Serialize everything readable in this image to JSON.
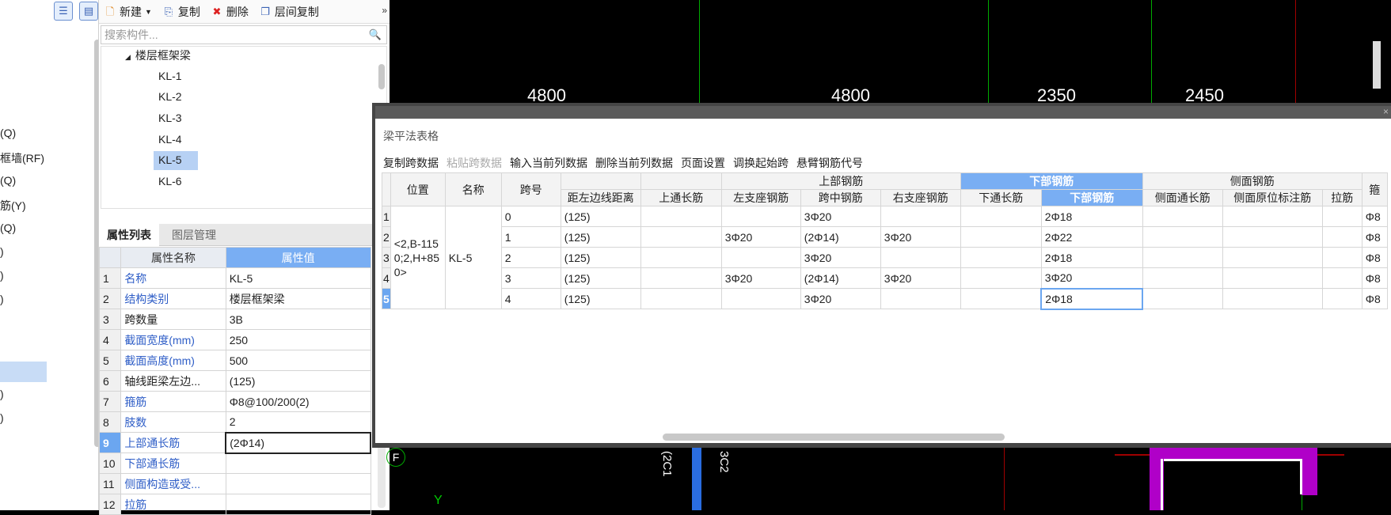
{
  "left_strip": {
    "labels": [
      "(Q)",
      "框墙(RF)",
      "(Q)",
      "筋(Y)",
      "(Q)",
      ")",
      ")",
      ")",
      ")",
      ")"
    ]
  },
  "toolbar": {
    "new": "新建",
    "copy": "复制",
    "delete": "删除",
    "floor_copy": "层间复制",
    "more": "»"
  },
  "search": {
    "placeholder": "搜索构件..."
  },
  "tree": {
    "group": "楼层框架梁",
    "items": [
      "KL-1",
      "KL-2",
      "KL-3",
      "KL-4",
      "KL-5",
      "KL-6"
    ],
    "selected": "KL-5"
  },
  "tabs": {
    "props": "属性列表",
    "layers": "图层管理"
  },
  "props": {
    "col_name": "属性名称",
    "col_value": "属性值",
    "rows": [
      {
        "n": "1",
        "k": "名称",
        "v": "KL-5",
        "blue": true
      },
      {
        "n": "2",
        "k": "结构类别",
        "v": "楼层框架梁",
        "blue": true
      },
      {
        "n": "3",
        "k": "跨数量",
        "v": "3B",
        "blue": false
      },
      {
        "n": "4",
        "k": "截面宽度(mm)",
        "v": "250",
        "blue": true
      },
      {
        "n": "5",
        "k": "截面高度(mm)",
        "v": "500",
        "blue": true
      },
      {
        "n": "6",
        "k": "轴线距梁左边...",
        "v": "(125)",
        "blue": false
      },
      {
        "n": "7",
        "k": "箍筋",
        "v": "Φ8@100/200(2)",
        "blue": true
      },
      {
        "n": "8",
        "k": "肢数",
        "v": "2",
        "blue": true
      },
      {
        "n": "9",
        "k": "上部通长筋",
        "v": "(2Φ14)",
        "blue": true
      },
      {
        "n": "10",
        "k": "下部通长筋",
        "v": "",
        "blue": true
      },
      {
        "n": "11",
        "k": "侧面构造或受...",
        "v": "",
        "blue": true
      },
      {
        "n": "12",
        "k": "拉筋",
        "v": "",
        "blue": true
      }
    ]
  },
  "cad": {
    "dims": [
      "4800",
      "4800",
      "2350",
      "2450"
    ],
    "marks": [
      "F",
      "Y",
      "(2C1",
      "3C2"
    ]
  },
  "grid_window": {
    "title": "梁平法表格",
    "close": "×",
    "tools": [
      "复制跨数据",
      "粘贴跨数据",
      "输入当前列数据",
      "删除当前列数据",
      "页面设置",
      "调换起始跨",
      "悬臂钢筋代号"
    ],
    "headers": {
      "position": "位置",
      "name": "名称",
      "span": "跨号",
      "top_steel": "上部钢筋",
      "bottom_steel": "下部钢筋",
      "side_steel": "侧面钢筋",
      "stirrup": "箍",
      "dist": "距左边线距离",
      "top_through": "上通长筋",
      "left_support": "左支座钢筋",
      "mid_span": "跨中钢筋",
      "right_support": "右支座钢筋",
      "bottom_through": "下通长筋",
      "bottom_bar": "下部钢筋",
      "side_through": "侧面通长筋",
      "side_orig": "侧面原位标注筋",
      "tie": "拉筋"
    },
    "position_value": "<2,B-1150;2,H+850>",
    "name_value": "KL-5",
    "rows": [
      {
        "rn": "1",
        "span": "0",
        "dist": "(125)",
        "left": "",
        "mid": "3Φ20",
        "right": "",
        "bottom": "2Φ18",
        "stir": "Φ8"
      },
      {
        "rn": "2",
        "span": "1",
        "dist": "(125)",
        "left": "3Φ20",
        "mid": "(2Φ14)",
        "right": "3Φ20",
        "bottom": "2Φ22",
        "stir": "Φ8"
      },
      {
        "rn": "3",
        "span": "2",
        "dist": "(125)",
        "left": "",
        "mid": "3Φ20",
        "right": "",
        "bottom": "2Φ18",
        "stir": "Φ8"
      },
      {
        "rn": "4",
        "span": "3",
        "dist": "(125)",
        "left": "3Φ20",
        "mid": "(2Φ14)",
        "right": "3Φ20",
        "bottom": "3Φ20",
        "stir": "Φ8"
      },
      {
        "rn": "5",
        "span": "4",
        "dist": "(125)",
        "left": "",
        "mid": "3Φ20",
        "right": "",
        "bottom": "2Φ18",
        "stir": "Φ8"
      }
    ]
  },
  "colors": {
    "accent": "#79aef3",
    "selection": "#b7d1f4",
    "label_blue": "#2f5ec7",
    "grid_green": "#00aa00",
    "magenta": "#b000c8"
  }
}
